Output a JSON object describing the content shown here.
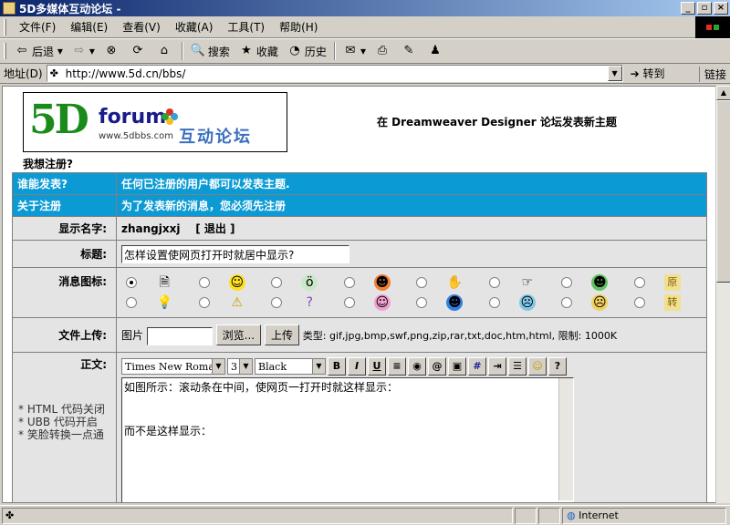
{
  "window": {
    "title": "5D多媒体互动论坛 -"
  },
  "menu": [
    "文件(F)",
    "编辑(E)",
    "查看(V)",
    "收藏(A)",
    "工具(T)",
    "帮助(H)"
  ],
  "toolbar": {
    "back": "后退",
    "forward": "",
    "search": "搜索",
    "favorites": "收藏",
    "history": "历史"
  },
  "address": {
    "label": "地址(D)",
    "url": "http://www.5d.cn/bbs/",
    "go": "转到",
    "links": "链接"
  },
  "logo": {
    "brand": "5D",
    "forum": "forum",
    "url": "www.5dbbs.com",
    "cn": "互动论坛"
  },
  "page": {
    "heading": "在 Dreamweaver Designer 论坛发表新主题",
    "register": "我想注册?"
  },
  "rows": {
    "who_label": "谁能发表?",
    "who_value": "任何已注册的用户都可以发表主题.",
    "about_label": "关于注册",
    "about_value": "为了发表新的消息，您必须先注册",
    "name_label": "显示名字:",
    "name_value": "zhangjxxj",
    "logout": "[ 退出 ]",
    "title_label": "标题:",
    "title_value": "怎样设置使网页打开时就居中显示?",
    "icon_label": "消息图标:",
    "upload_label": "文件上传:",
    "upload_type_label": "图片",
    "browse": "浏览...",
    "upload_btn": "上传",
    "types": "类型: gif,jpg,bmp,swf,png,zip,rar,txt,doc,htm,html, 限制: 1000K",
    "body_label": "正文:",
    "notes": [
      "* HTML 代码关闭",
      "* UBB  代码开启",
      "* 笑脸转换一点通"
    ]
  },
  "editor": {
    "font": "Times New Roman",
    "size": "3",
    "color": "Black",
    "lines": [
      "如图所示：滚动条在中间，使网页一打开时就这样显示：",
      "",
      "",
      "而不是这样显示："
    ]
  },
  "status": {
    "zone": "Internet"
  }
}
